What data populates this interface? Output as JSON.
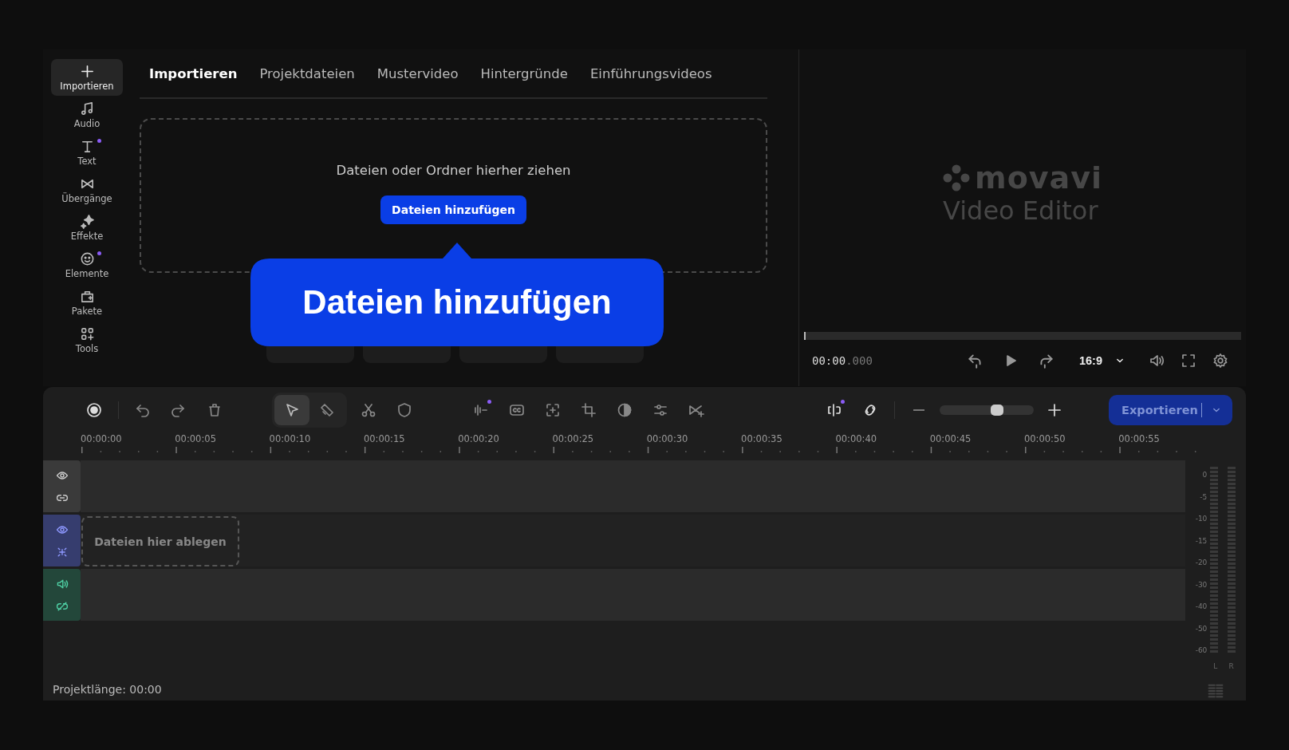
{
  "sidebar": {
    "items": [
      {
        "label": "Importieren",
        "selected": true,
        "dot": false
      },
      {
        "label": "Audio",
        "selected": false,
        "dot": false
      },
      {
        "label": "Text",
        "selected": false,
        "dot": true
      },
      {
        "label": "Übergänge",
        "selected": false,
        "dot": false
      },
      {
        "label": "Effekte",
        "selected": false,
        "dot": false
      },
      {
        "label": "Elemente",
        "selected": false,
        "dot": true
      },
      {
        "label": "Pakete",
        "selected": false,
        "dot": false
      },
      {
        "label": "Tools",
        "selected": false,
        "dot": false
      }
    ]
  },
  "tabs": [
    {
      "label": "Importieren",
      "selected": true
    },
    {
      "label": "Projektdateien",
      "selected": false
    },
    {
      "label": "Mustervideo",
      "selected": false
    },
    {
      "label": "Hintergründe",
      "selected": false
    },
    {
      "label": "Einführungsvideos",
      "selected": false
    }
  ],
  "import_area": {
    "hint": "Dateien oder Ordner hierher ziehen",
    "button": "Dateien hinzufügen"
  },
  "callout": {
    "text": "Dateien hinzufügen"
  },
  "preview": {
    "position": {
      "level": 0
    },
    "logo": "movavi",
    "subtitle": "Video Editor",
    "timecode": "00:00",
    "timecode_fraction": ".000",
    "aspect_ratio": "16:9"
  },
  "toolbar": {
    "mode_tools": [
      {
        "selected": true
      },
      {
        "selected": false
      }
    ],
    "clip_tools": [
      {
        "dot": true
      },
      {
        "dot": false
      },
      {
        "dot": false
      },
      {
        "dot": false
      },
      {
        "dot": false
      },
      {
        "dot": false
      },
      {
        "dot": false
      }
    ],
    "audio_tools": [
      {
        "dot": true
      },
      {
        "dot": false
      }
    ],
    "zoom": {
      "level": 0.6
    },
    "export_button": "Exportieren"
  },
  "ruler": {
    "labels": [
      "00:00:00",
      "00:00:05",
      "00:00:10",
      "00:00:15",
      "00:00:20",
      "00:00:25",
      "00:00:30",
      "00:00:35",
      "00:00:40",
      "00:00:45",
      "00:00:50",
      "00:00:55"
    ]
  },
  "tracks": [
    {
      "kind": "overlay"
    },
    {
      "kind": "video",
      "drop_hint": "Dateien hier ablegen"
    },
    {
      "kind": "audio"
    }
  ],
  "meter": {
    "scale": [
      "0",
      "-5",
      "-10",
      "-15",
      "-20",
      "-30",
      "-40",
      "-50",
      "-60"
    ],
    "channels": [
      "L",
      "R"
    ]
  },
  "status_bar": {
    "project_length": "Projektlänge: 00:00"
  }
}
